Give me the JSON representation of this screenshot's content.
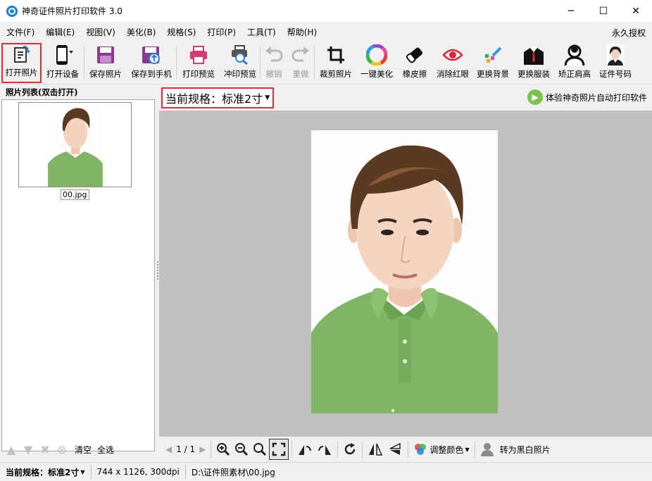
{
  "window": {
    "title": "神奇证件照片打印软件 3.0",
    "minimize_glyph": "─",
    "maximize_glyph": "☐",
    "close_glyph": "✕"
  },
  "menu": {
    "items": [
      "文件(F)",
      "编辑(E)",
      "视图(V)",
      "美化(B)",
      "规格(S)",
      "打印(P)",
      "工具(T)",
      "帮助(H)"
    ],
    "license": "永久授权"
  },
  "toolbar": {
    "open_photo": "打开照片",
    "open_device": "打开设备",
    "save_photo": "保存照片",
    "save_to_phone": "保存到手机",
    "print_preview": "打印预览",
    "develop_preview": "冲印预览",
    "undo": "撤销",
    "redo": "重做",
    "crop": "裁剪照片",
    "one_click_beautify": "一键美化",
    "eraser": "橡皮擦",
    "remove_red_eye": "消除红眼",
    "change_background": "更换背景",
    "change_clothes": "更换服装",
    "correct_shoulders": "矫正肩高",
    "id_number": "证件号码"
  },
  "left_panel": {
    "header": "照片列表(双击打开)",
    "thumbnail_caption": "00.jpg",
    "clear": "清空",
    "select_all": "全选"
  },
  "spec_bar": {
    "label": "当前规格：",
    "value": "标准2寸",
    "auto_print": "体验神奇照片自动打印软件"
  },
  "view_toolbar": {
    "page_indicator": "1 / 1",
    "adjust_color": "调整颜色",
    "to_grayscale": "转为黑白照片"
  },
  "status": {
    "spec_label": "当前规格：",
    "spec_value": "标准2寸",
    "dimensions": "744 x 1126, 300dpi",
    "path": "D:\\证件照素材\\00.jpg"
  },
  "colors": {
    "highlight": "#e0303a",
    "canvas_bg": "#c0c0c0",
    "shirt": "#7fb565",
    "hair": "#5a3a22"
  }
}
